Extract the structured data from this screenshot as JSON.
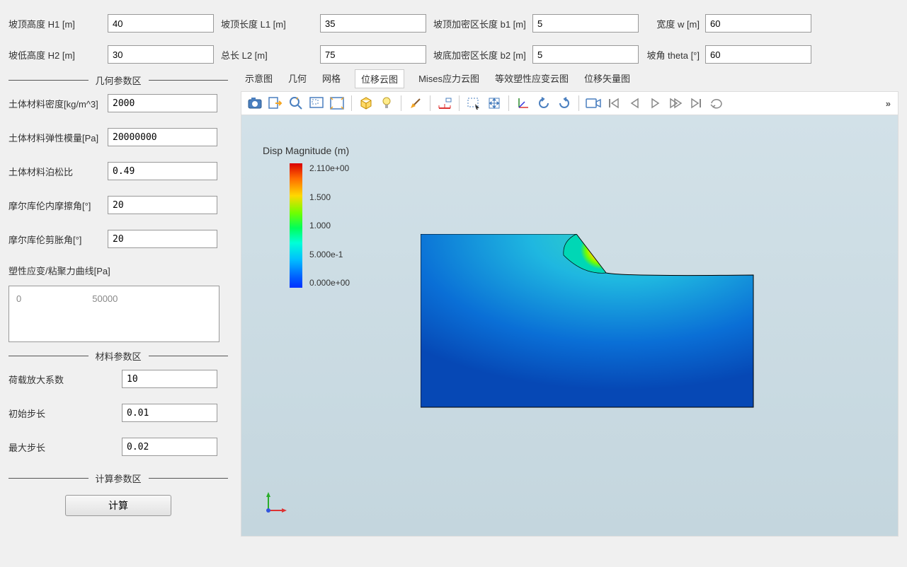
{
  "top_params": {
    "h1": {
      "label": "坡顶高度 H1 [m]",
      "value": "40"
    },
    "l1": {
      "label": "坡顶长度 L1 [m]",
      "value": "35"
    },
    "b1": {
      "label": "坡顶加密区长度 b1 [m]",
      "value": "5"
    },
    "w": {
      "label": "宽度 w [m]",
      "value": "60"
    },
    "h2": {
      "label": "坡低高度 H2 [m]",
      "value": "30"
    },
    "l2": {
      "label": "总长 L2 [m]",
      "value": "75"
    },
    "b2": {
      "label": "坡底加密区长度 b2 [m]",
      "value": "5"
    },
    "theta": {
      "label": "坡角 theta [°]",
      "value": "60"
    }
  },
  "sections": {
    "geometry": "几何参数区",
    "material": "材料参数区",
    "compute": "计算参数区"
  },
  "material_params": {
    "density": {
      "label": "土体材料密度[kg/m^3]",
      "value": "2000"
    },
    "elastic": {
      "label": "土体材料弹性模量[Pa]",
      "value": "20000000"
    },
    "poisson": {
      "label": "土体材料泊松比",
      "value": "0.49"
    },
    "friction": {
      "label": "摩尔库伦内摩擦角[°]",
      "value": "20"
    },
    "dilation": {
      "label": "摩尔库伦剪胀角[°]",
      "value": "20"
    },
    "curve_label": "塑性应变/粘聚力曲线[Pa]",
    "curve_col1": "0",
    "curve_col2": "50000"
  },
  "compute_params": {
    "load_factor": {
      "label": "荷载放大系数",
      "value": "10"
    },
    "init_step": {
      "label": "初始步长",
      "value": "0.01"
    },
    "max_step": {
      "label": "最大步长",
      "value": "0.02"
    },
    "button": "计算"
  },
  "tabs": [
    "示意图",
    "几何",
    "网格",
    "位移云图",
    "Mises应力云图",
    "等效塑性应变云图",
    "位移矢量图"
  ],
  "active_tab": "位移云图",
  "legend": {
    "title": "Disp Magnitude (m)",
    "ticks": [
      "2.110e+00",
      "1.500",
      "1.000",
      "5.000e-1",
      "0.000e+00"
    ]
  },
  "toolbar_more": "»"
}
